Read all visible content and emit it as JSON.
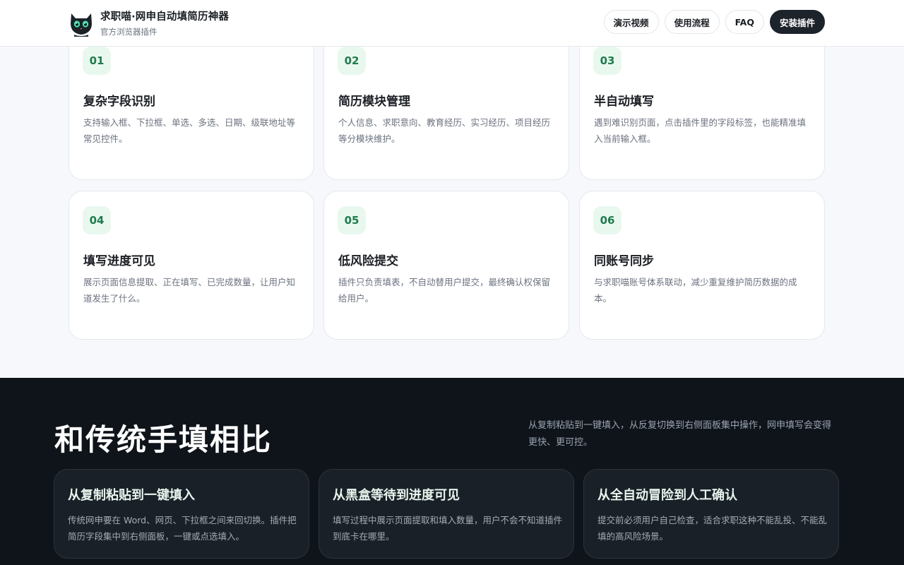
{
  "header": {
    "brand_title": "求职喵·网申自动填简历神器",
    "brand_subtitle": "官方浏览器插件",
    "nav": [
      {
        "label": "演示视频"
      },
      {
        "label": "使用流程"
      },
      {
        "label": "FAQ"
      },
      {
        "label": "安装插件"
      }
    ]
  },
  "features": [
    {
      "number": "01",
      "title": "复杂字段识别",
      "desc": "支持输入框、下拉框、单选、多选、日期、级联地址等常见控件。"
    },
    {
      "number": "02",
      "title": "简历模块管理",
      "desc": "个人信息、求职意向、教育经历、实习经历、项目经历等分模块维护。"
    },
    {
      "number": "03",
      "title": "半自动填写",
      "desc": "遇到难识别页面，点击插件里的字段标签，也能精准填入当前输入框。"
    },
    {
      "number": "04",
      "title": "填写进度可见",
      "desc": "展示页面信息提取、正在填写、已完成数量，让用户知道发生了什么。"
    },
    {
      "number": "05",
      "title": "低风险提交",
      "desc": "插件只负责填表，不自动替用户提交，最终确认权保留给用户。"
    },
    {
      "number": "06",
      "title": "同账号同步",
      "desc": "与求职喵账号体系联动，减少重复维护简历数据的成本。"
    }
  ],
  "compare": {
    "title": "和传统手填相比",
    "desc": "从复制粘贴到一键填入，从反复切换到右侧面板集中操作，网申填写会变得更快、更可控。",
    "cards": [
      {
        "title": "从复制粘贴到一键填入",
        "desc": "传统网申要在 Word、网页、下拉框之间来回切换。插件把简历字段集中到右侧面板，一键或点选填入。"
      },
      {
        "title": "从黑盒等待到进度可见",
        "desc": "填写过程中展示页面提取和填入数量，用户不会不知道插件到底卡在哪里。"
      },
      {
        "title": "从全自动冒险到人工确认",
        "desc": "提交前必须用户自己检查，适合求职这种不能乱投、不能乱填的高风险场景。"
      }
    ]
  },
  "colors": {
    "accent_green": "#1f7a4c",
    "badge_bg": "#e9f8ef",
    "dark_bg": "#0f141b",
    "primary_button": "#1d232b"
  }
}
